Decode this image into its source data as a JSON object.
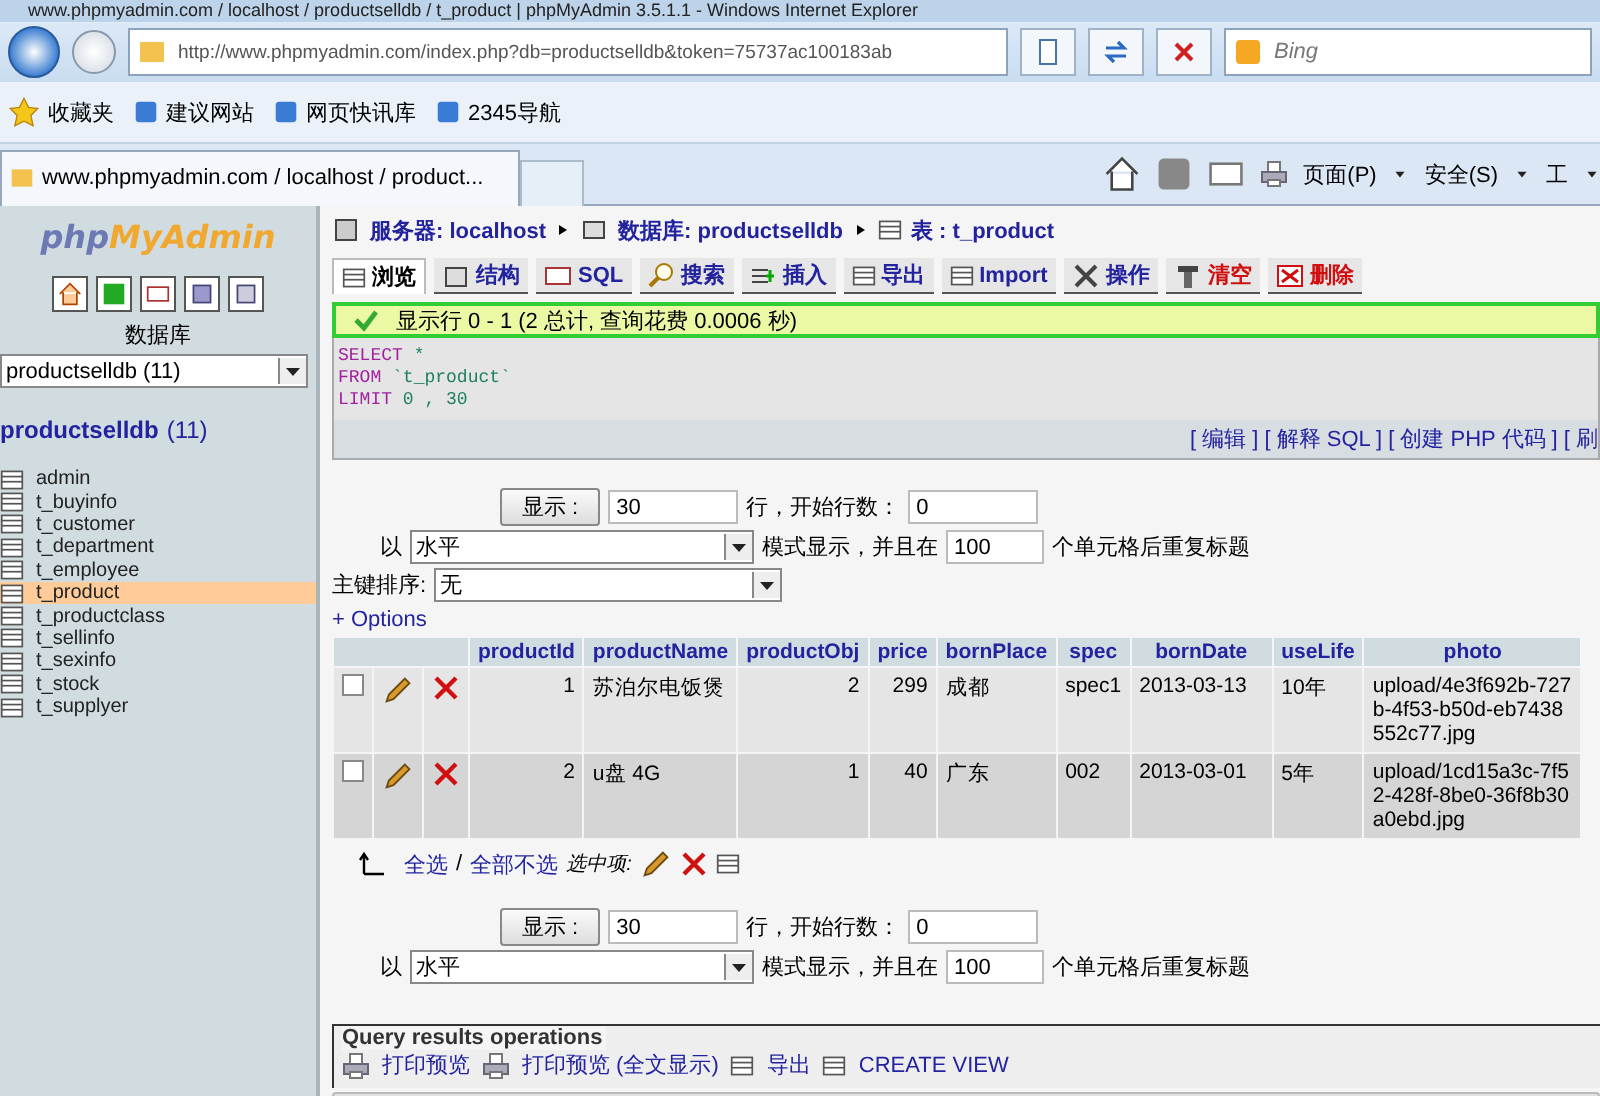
{
  "window": {
    "title": "www.phpmyadmin.com / localhost / productselldb / t_product | phpMyAdmin 3.5.1.1 - Windows Internet Explorer"
  },
  "browser": {
    "address": "http://www.phpmyadmin.com/index.php?db=productselldb&token=75737ac100183ab",
    "search_placeholder": "Bing",
    "favorites_label": "收藏夹",
    "favorites": [
      "建议网站",
      "网页快讯库",
      "2345导航"
    ],
    "tab_title": "www.phpmyadmin.com / localhost / product...",
    "commands": [
      "页面(P)",
      "安全(S)",
      "工"
    ]
  },
  "sidebar": {
    "logo_php": "php",
    "logo_rest": "MyAdmin",
    "database_label": "数据库",
    "db_select": "productselldb (11)",
    "db_title": "productselldb",
    "db_count": "(11)",
    "tables": [
      {
        "name": "admin",
        "selected": false
      },
      {
        "name": "t_buyinfo",
        "selected": false
      },
      {
        "name": "t_customer",
        "selected": false
      },
      {
        "name": "t_department",
        "selected": false
      },
      {
        "name": "t_employee",
        "selected": false
      },
      {
        "name": "t_product",
        "selected": true
      },
      {
        "name": "t_productclass",
        "selected": false
      },
      {
        "name": "t_sellinfo",
        "selected": false
      },
      {
        "name": "t_sexinfo",
        "selected": false
      },
      {
        "name": "t_stock",
        "selected": false
      },
      {
        "name": "t_supplyer",
        "selected": false
      }
    ]
  },
  "breadcrumb": [
    {
      "label": "服务器:",
      "value": "localhost"
    },
    {
      "label": "数据库:",
      "value": "productselldb"
    },
    {
      "label": "表 :",
      "value": "t_product"
    }
  ],
  "tabs": [
    {
      "label": "浏览",
      "selected": true,
      "kind": "normal"
    },
    {
      "label": "结构",
      "selected": false,
      "kind": "normal"
    },
    {
      "label": "SQL",
      "selected": false,
      "kind": "normal"
    },
    {
      "label": "搜索",
      "selected": false,
      "kind": "normal"
    },
    {
      "label": "插入",
      "selected": false,
      "kind": "normal"
    },
    {
      "label": "导出",
      "selected": false,
      "kind": "normal"
    },
    {
      "label": "Import",
      "selected": false,
      "kind": "normal"
    },
    {
      "label": "操作",
      "selected": false,
      "kind": "normal"
    },
    {
      "label": "清空",
      "selected": false,
      "kind": "danger"
    },
    {
      "label": "删除",
      "selected": false,
      "kind": "danger"
    }
  ],
  "message": "显示行 0 - 1 (2 总计, 查询花费 0.0006 秒)",
  "sql": [
    {
      "keyword": "SELECT",
      "text": "*"
    },
    {
      "keyword": "FROM",
      "text": "`t_product`"
    },
    {
      "keyword": "LIMIT",
      "text": "0 , 30"
    }
  ],
  "sql_links": [
    "[ 编辑 ]",
    "[ 解释 SQL ]",
    "[ 创建 PHP 代码 ]",
    "[ 刷"
  ],
  "nav_forms": [
    {
      "button": "显示 :",
      "rows": "30",
      "rows_label": "行，开始行数：",
      "start": "0",
      "mode_prefix": "以",
      "mode": "水平",
      "mode_label": "模式显示，并且在",
      "repeat": "100",
      "repeat_label": "个单元格后重复标题"
    },
    {
      "button": "显示 :",
      "rows": "30",
      "rows_label": "行，开始行数：",
      "start": "0",
      "mode_prefix": "以",
      "mode": "水平",
      "mode_label": "模式显示，并且在",
      "repeat": "100",
      "repeat_label": "个单元格后重复标题"
    }
  ],
  "sort": {
    "label": "主键排序:",
    "value": "无"
  },
  "options_link": "+ Options",
  "table": {
    "columns": [
      "productId",
      "productName",
      "productObj",
      "price",
      "bornPlace",
      "spec",
      "bornDate",
      "useLife",
      "photo"
    ],
    "rows": [
      {
        "checked": false,
        "cells": [
          "1",
          "苏泊尔电饭煲",
          "2",
          "299",
          "成都",
          "spec1",
          "2013-03-13",
          "10年",
          "upload/4e3f692b-727b-4f53-b50d-eb7438552c77.jpg"
        ]
      },
      {
        "checked": false,
        "cells": [
          "2",
          "u盘 4G",
          "1",
          "40",
          "广东",
          "002",
          "2013-03-01",
          "5年",
          "upload/1cd15a3c-7f52-428f-8be0-36f8b30a0ebd.jpg"
        ]
      }
    ]
  },
  "footer": {
    "check_all": "全选",
    "separator": "/",
    "uncheck_all": "全部不选",
    "with_selected": "选中项:"
  },
  "query_ops": {
    "title": "Query results operations",
    "links": [
      {
        "label": "打印预览",
        "kind": "print"
      },
      {
        "label": "打印预览 (全文显示)",
        "kind": "print"
      },
      {
        "label": "导出",
        "kind": "export"
      },
      {
        "label": "CREATE VIEW",
        "kind": "view"
      }
    ]
  }
}
